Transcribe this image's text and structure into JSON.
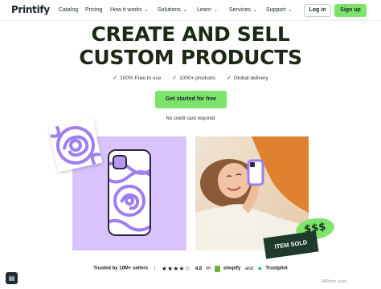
{
  "brand": {
    "name": "Printify"
  },
  "nav": {
    "items": [
      {
        "label": "Catalog",
        "dropdown": false
      },
      {
        "label": "Pricing",
        "dropdown": false
      },
      {
        "label": "How it works",
        "dropdown": true
      },
      {
        "label": "Solutions",
        "dropdown": true
      },
      {
        "label": "Learn",
        "dropdown": true
      },
      {
        "label": "Services",
        "dropdown": true
      },
      {
        "label": "Support",
        "dropdown": true
      }
    ],
    "chevron": "⌄",
    "login_label": "Log in",
    "signup_label": "Sign up"
  },
  "hero": {
    "headline_line1": "CREATE AND SELL",
    "headline_line2": "CUSTOM PRODUCTS",
    "features": [
      {
        "icon": "check-icon",
        "label": "100% Free to use"
      },
      {
        "icon": "check-icon",
        "label": "1000+ products"
      },
      {
        "icon": "check-icon",
        "label": "Global delivery"
      }
    ],
    "check_glyph": "✓",
    "cta_label": "Get started for free",
    "subnote": "No credit card required"
  },
  "showcase": {
    "price_badge": "$$$",
    "sold_badge": "ITEM SOLD"
  },
  "trust": {
    "sellers": "Trusted by 10M+ sellers",
    "separator": "|",
    "stars": "★★★★☆",
    "rating": "4.8",
    "on": "on",
    "shopify": "shopify",
    "and": "and",
    "trustpilot": "Trustpilot",
    "trustpilot_star": "★"
  },
  "chat": {
    "icon": "chat-icon"
  },
  "watermark": "WPism.com",
  "colors": {
    "accent_green": "#7ee36a",
    "lavender": "#d8c4fb",
    "swirl_purple": "#9e7ef0",
    "dark_text": "#17262b",
    "trustpilot_green": "#00b67a"
  }
}
